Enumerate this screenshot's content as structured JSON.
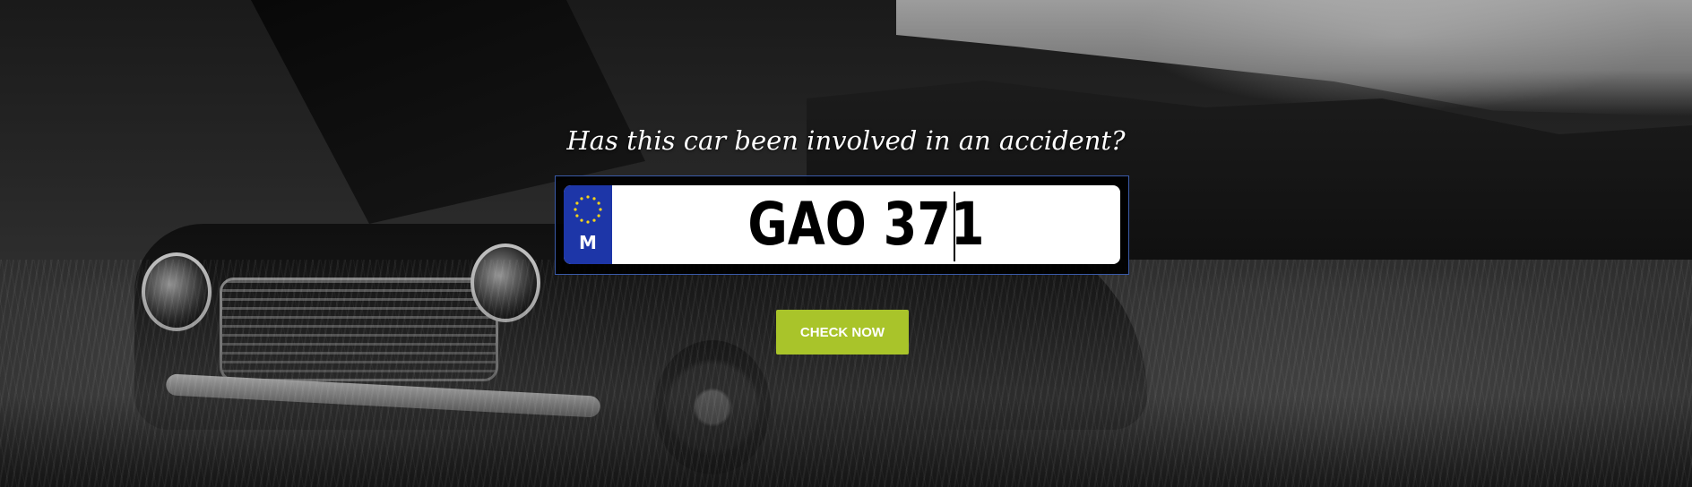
{
  "hero": {
    "question": "Has this car been involved in an accident?",
    "background_image": "black-and-white-wrecked-vintage-car-in-field"
  },
  "plate": {
    "value": "GAO 371",
    "country_code": "M",
    "flag_icon": "eu-stars-icon",
    "strip_color": "#1d36a8"
  },
  "actions": {
    "check_label": "CHECK NOW",
    "button_color": "#a9c42a"
  }
}
